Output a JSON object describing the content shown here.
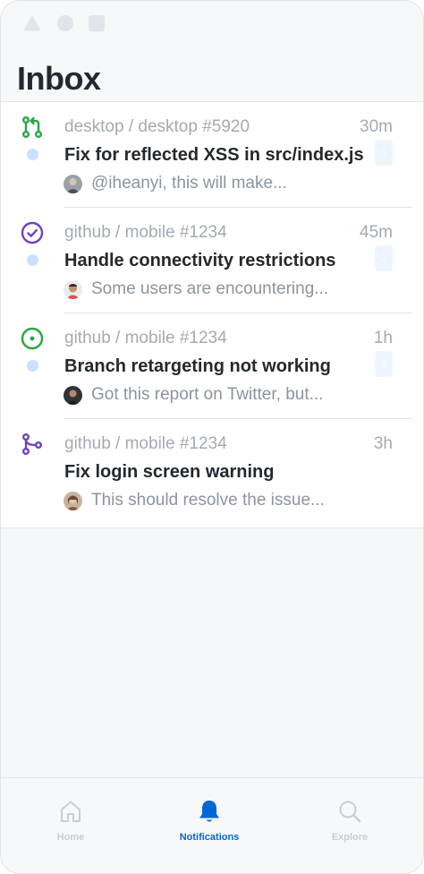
{
  "header": {
    "title": "Inbox"
  },
  "notifications": [
    {
      "type": "pull-request",
      "icon": "pull-request-icon",
      "icon_color": "#28a745",
      "repo": "desktop / desktop #5920",
      "time": "30m",
      "subject": "Fix for reflected XSS in src/index.js",
      "count": "1",
      "preview": "@iheanyi, this will make...",
      "unread": true
    },
    {
      "type": "issue-closed",
      "icon": "check-circle-icon",
      "icon_color": "#6f42c1",
      "repo": "github / mobile #1234",
      "time": "45m",
      "subject": "Handle connectivity restrictions",
      "count": "1",
      "preview": "Some users are encountering...",
      "unread": true
    },
    {
      "type": "issue-open",
      "icon": "issue-opened-icon",
      "icon_color": "#28a745",
      "repo": "github / mobile #1234",
      "time": "1h",
      "subject": "Branch retargeting not working",
      "count": "3",
      "preview": "Got this report on Twitter, but...",
      "unread": true
    },
    {
      "type": "pr-merged",
      "icon": "merge-icon",
      "icon_color": "#6f42c1",
      "repo": "github / mobile #1234",
      "time": "3h",
      "subject": "Fix login screen warning",
      "count": "",
      "preview": "This should resolve the issue...",
      "unread": false
    }
  ],
  "tabbar": {
    "home_label": "Home",
    "notifications_label": "Notifications",
    "explore_label": "Explore",
    "active": "notifications",
    "active_color": "#0366d6"
  }
}
